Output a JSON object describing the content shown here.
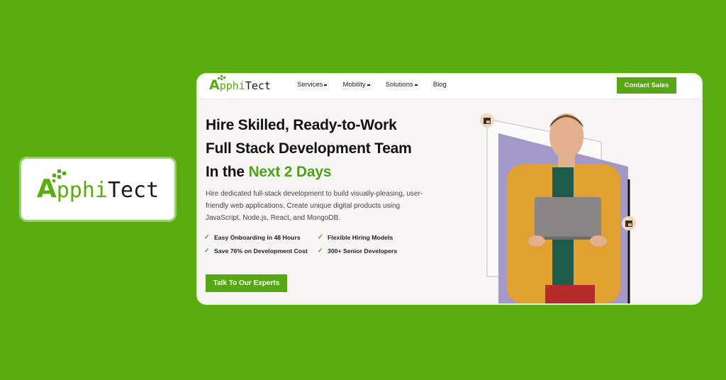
{
  "brand": {
    "logo_a": "A",
    "logo_phi": "pphi",
    "logo_tect": "Tect",
    "accent_color": "#5aad0f"
  },
  "header": {
    "nav": [
      {
        "label": "Services",
        "has_dropdown": true
      },
      {
        "label": "Mobility",
        "has_dropdown": true
      },
      {
        "label": "Solutions",
        "has_dropdown": true
      },
      {
        "label": "Blog",
        "has_dropdown": false
      }
    ],
    "contact_label": "Contact Sales"
  },
  "hero": {
    "title_line1": "Hire Skilled, Ready-to-Work",
    "title_line2": "Full Stack Development Team",
    "title_line3_prefix": "In the ",
    "title_line3_highlight": "Next 2 Days",
    "description": "Hire dedicated full-stack development to build visually-pleasing, user-friendly web applications. Create unique digital products using JavaScript, Node.js, React, and MongoDB.",
    "features": [
      "Easy Onboarding in 48 Hours",
      "Flexible Hiring Models",
      "Save 76% on Development Cost",
      "300+ Senior Developers"
    ],
    "cta_label": "Talk To Our Experts",
    "check_icon": "✓"
  }
}
